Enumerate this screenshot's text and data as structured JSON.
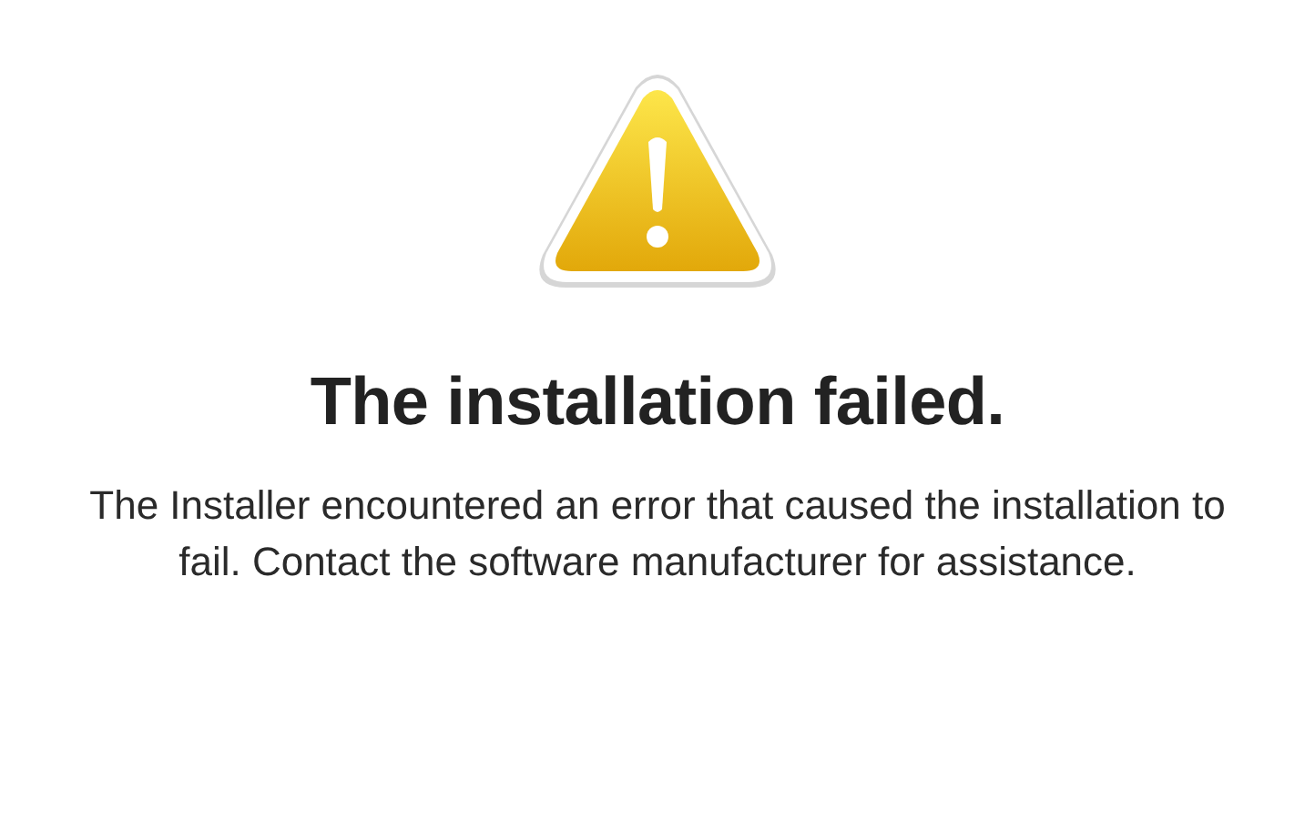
{
  "alert": {
    "title": "The installation failed.",
    "message": "The Installer encountered an error that caused the installation to fail. Contact the software manufacturer for assistance."
  }
}
